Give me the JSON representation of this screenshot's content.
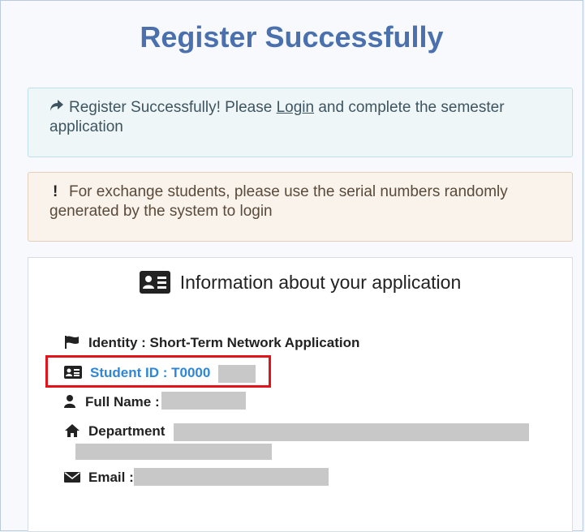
{
  "page": {
    "title": "Register Successfully"
  },
  "alerts": {
    "success": {
      "icon": "share-arrow-icon",
      "text_before": "Register Successfully! Please ",
      "link": "Login",
      "text_after": " and complete the semester application"
    },
    "warning": {
      "icon": "exclamation-icon",
      "text": "For exchange students, please use the serial numbers randomly generated by the system to login"
    }
  },
  "info": {
    "heading": "Information about your application",
    "identity": {
      "icon": "flag-icon",
      "label": "Identity : Short-Term Network Application"
    },
    "student_id": {
      "icon": "id-card-icon",
      "label": "Student ID : T0000"
    },
    "full_name": {
      "icon": "user-icon",
      "label": "Full Name :"
    },
    "department": {
      "icon": "home-icon",
      "label": "Department"
    },
    "email": {
      "icon": "envelope-icon",
      "label": "Email :"
    }
  },
  "colors": {
    "title": "#4a70ad",
    "student_id": "#2e86d6",
    "highlight_border": "#e3131a"
  }
}
